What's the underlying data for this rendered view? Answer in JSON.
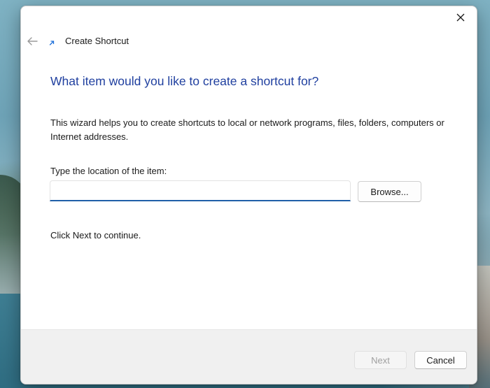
{
  "window": {
    "title": "Create Shortcut",
    "heading": "What item would you like to create a shortcut for?",
    "description": "This wizard helps you to create shortcuts to local or network programs, files, folders, computers or Internet addresses.",
    "location_label": "Type the location of the item:",
    "location_value": "",
    "browse_label": "Browse...",
    "continue_text": "Click Next to continue."
  },
  "footer": {
    "next_label": "Next",
    "cancel_label": "Cancel",
    "next_enabled": false
  },
  "icons": {
    "close": "close-icon",
    "back": "back-arrow-icon",
    "wizard": "shortcut-arrow-icon"
  },
  "colors": {
    "heading": "#1f3f9f",
    "input_underline": "#1f5fa8",
    "footer_bg": "#f0f0f0"
  }
}
